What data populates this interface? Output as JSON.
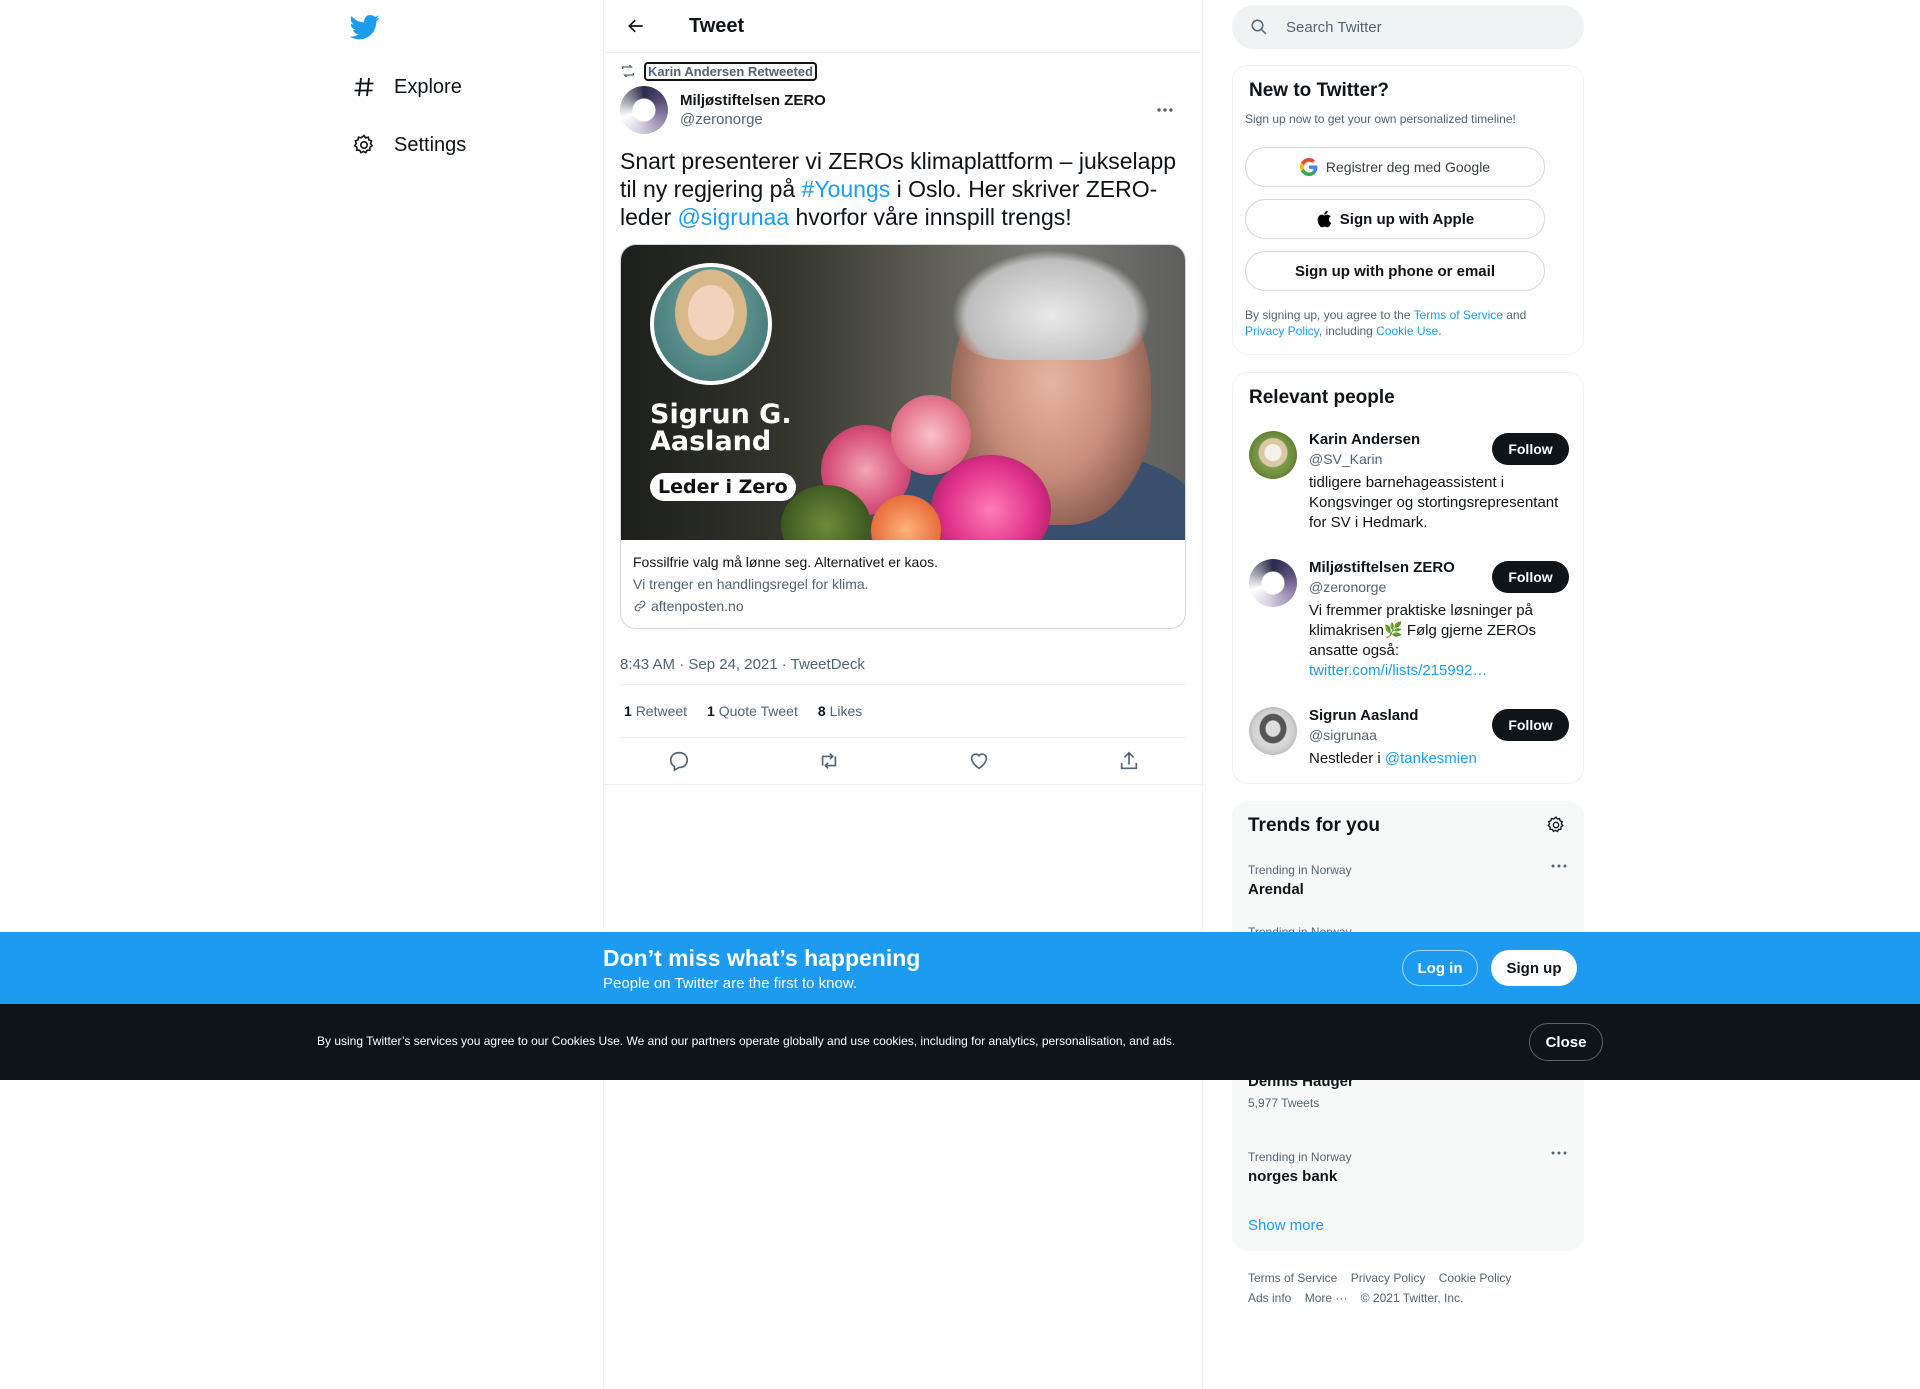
{
  "nav": {
    "items": [
      {
        "label": "Explore",
        "icon": "hashtag-icon"
      },
      {
        "label": "Settings",
        "icon": "gear-icon"
      }
    ]
  },
  "header": {
    "title": "Tweet"
  },
  "tweet": {
    "retweeted_by": "Karin Andersen Retweeted",
    "author_name": "Miljøstiftelsen ZERO",
    "author_handle": "@zeronorge",
    "text_parts": {
      "p1": "Snart presenterer vi ZEROs klimaplattform – jukselapp til ny regjering på ",
      "hashtag": "#Youngs",
      "p2": " i Oslo. Her skriver ZERO-leder ",
      "mention": "@sigrunaa",
      "p3": " hvorfor våre innspill trengs!"
    },
    "card": {
      "image_name": "Sigrun G. Aasland",
      "image_badge": "Leder i Zero",
      "title": "Fossilfrie valg må lønne seg. Alternativet er kaos.",
      "description": "Vi trenger en handlingsregel for klima.",
      "domain": "aftenposten.no"
    },
    "timestamp": "8:43 AM · Sep 24, 2021 · TweetDeck",
    "stats": {
      "retweets_count": "1",
      "retweets_label": "Retweet",
      "quotes_count": "1",
      "quotes_label": "Quote Tweet",
      "likes_count": "8",
      "likes_label": "Likes"
    }
  },
  "search": {
    "placeholder": "Search Twitter"
  },
  "new_to_twitter": {
    "title": "New to Twitter?",
    "subtitle": "Sign up now to get your own personalized timeline!",
    "google_label": "Registrer deg med Google",
    "apple_label": "Sign up with Apple",
    "phone_label": "Sign up with phone or email",
    "terms_p1": "By signing up, you agree to the ",
    "terms_link": "Terms of Service",
    "terms_p2": " and ",
    "privacy_link": "Privacy Policy",
    "terms_p3": ", including ",
    "cookie_link": "Cookie Use",
    "terms_p4": "."
  },
  "relevant_people": {
    "title": "Relevant people",
    "follow_label": "Follow",
    "people": [
      {
        "name": "Karin Andersen",
        "handle": "@SV_Karin",
        "bio": "tidligere barnehageassistent i Kongsvinger og stortingsrepresentant for SV i Hedmark."
      },
      {
        "name": "Miljøstiftelsen ZERO",
        "handle": "@zeronorge",
        "bio": "Vi fremmer praktiske løsninger på klimakrisen🌿 Følg gjerne ZEROs ansatte også:",
        "link": "twitter.com/i/lists/215992…"
      },
      {
        "name": "Sigrun Aasland",
        "handle": "@sigrunaa",
        "bio": "Nestleder i ",
        "link": "@tankesmien"
      }
    ]
  },
  "trends": {
    "title": "Trends for you",
    "items": [
      {
        "category": "Trending in Norway",
        "title": "Arendal"
      },
      {
        "category": "Trending in Norway",
        "title": ""
      },
      {
        "category": "",
        "title": "Dennis Hauger",
        "count": "5,977 Tweets"
      },
      {
        "category": "Trending in Norway",
        "title": "norges bank"
      }
    ],
    "show_more": "Show more"
  },
  "footer": {
    "links": [
      "Terms of Service",
      "Privacy Policy",
      "Cookie Policy",
      "Ads info",
      "More ···",
      "© 2021 Twitter, Inc."
    ]
  },
  "banner": {
    "heading": "Don’t miss what’s happening",
    "sub": "People on Twitter are the first to know.",
    "login_label": "Log in",
    "signup_label": "Sign up"
  },
  "cookie_bar": {
    "text": "By using Twitter’s services you agree to our Cookies Use. We and our partners operate globally and use cookies, including for analytics, personalisation, and ads.",
    "close_label": "Close"
  },
  "colors": {
    "accent": "#1d9bf0",
    "text": "#0f1419",
    "muted": "#536471",
    "dark": "#0f1419"
  }
}
